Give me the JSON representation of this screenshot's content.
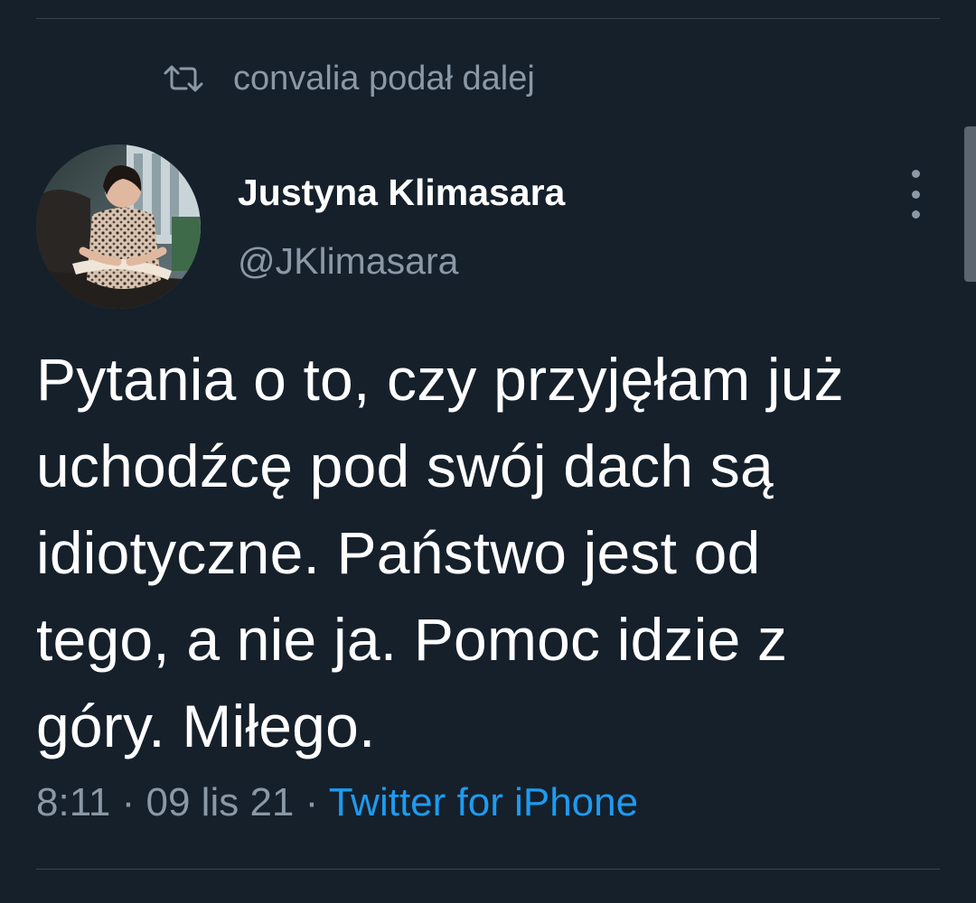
{
  "retweet": {
    "icon": "retweet-icon",
    "text": "convalia podał dalej"
  },
  "author": {
    "name": "Justyna Klimasara",
    "handle": "@JKlimasara"
  },
  "more_icon": "more-vertical-icon",
  "tweet": {
    "lines": [
      "Pytania o to, czy przyjęłam już",
      "uchodźcę pod swój dach są",
      "idiotyczne. Państwo jest od",
      "tego, a nie ja. Pomoc idzie z",
      "góry. Miłego."
    ]
  },
  "meta": {
    "time": "8:11",
    "separator": "·",
    "date": "09 lis 21",
    "source": "Twitter for iPhone"
  },
  "colors": {
    "background": "#15202b",
    "primary_text": "#ffffff",
    "secondary_text": "#8b98a5",
    "accent": "#1d9bf0"
  }
}
